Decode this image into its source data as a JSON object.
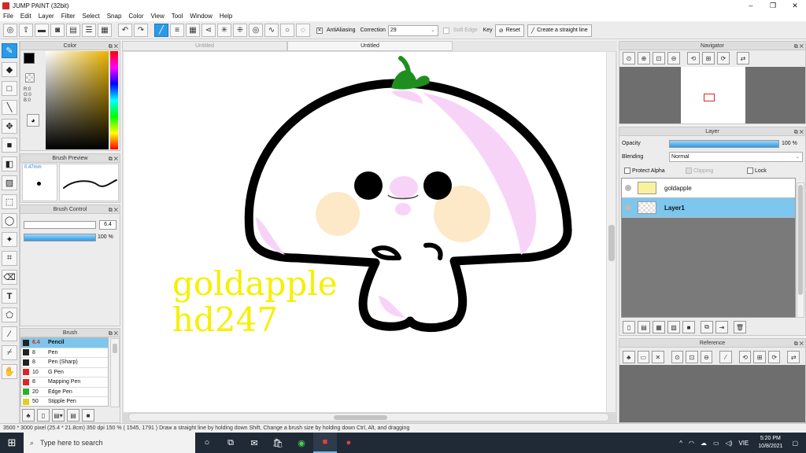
{
  "app": {
    "title": "JUMP PAINT (32bit)",
    "window_buttons": [
      "–",
      "❐",
      "✕"
    ]
  },
  "menu": [
    "File",
    "Edit",
    "Layer",
    "Filter",
    "Select",
    "Snap",
    "Color",
    "View",
    "Tool",
    "Window",
    "Help"
  ],
  "toolbar": {
    "antialiasing_label": "AntiAliasing",
    "correction_label": "Correction",
    "correction_value": "29",
    "soft_edge_label": "Soft Edge",
    "key_label": "Key",
    "reset_label": "Reset",
    "straight_line_label": "Create a straight line"
  },
  "color_panel": {
    "title": "Color",
    "r": "R:0",
    "g": "G:0",
    "b": "B:0",
    "fg_color": "#000000",
    "bg_color": "#f3b4e0"
  },
  "brush_preview": {
    "title": "Brush Preview",
    "size": "0.47mm"
  },
  "brush_control": {
    "title": "Brush Control",
    "size_value": "6.4",
    "size_fraction": 0.0,
    "opacity_value": "100 %",
    "opacity_fraction": 1.0
  },
  "brush_panel": {
    "title": "Brush",
    "items": [
      {
        "size": "6.4",
        "name": "Pencil",
        "color": "#222222"
      },
      {
        "size": "8",
        "name": "Pen",
        "color": "#222222"
      },
      {
        "size": "8",
        "name": "Pen (Sharp)",
        "color": "#222222"
      },
      {
        "size": "10",
        "name": "G Pen",
        "color": "#e02424"
      },
      {
        "size": "8",
        "name": "Mapping Pen",
        "color": "#e02424"
      },
      {
        "size": "20",
        "name": "Edge Pen",
        "color": "#2ab02a"
      },
      {
        "size": "50",
        "name": "Stipple Pen",
        "color": "#e0d020"
      }
    ]
  },
  "tabs": [
    {
      "label": "Untitled"
    },
    {
      "label": "Untitled"
    }
  ],
  "canvas_text": {
    "line1": "goldapple",
    "line2": "hd247"
  },
  "navigator": {
    "title": "Navigator"
  },
  "layer_panel": {
    "title": "Layer",
    "opacity_label": "Opacity",
    "opacity_value": "100 %",
    "opacity_fraction": 1.0,
    "blending_label": "Blending",
    "blending_value": "Normal",
    "protect_alpha": "Protect Alpha",
    "clipping": "Clipping",
    "lock": "Lock",
    "layers": [
      {
        "name": "goldapple"
      },
      {
        "name": "Layer1"
      }
    ]
  },
  "reference": {
    "title": "Reference"
  },
  "status": "3500 * 3000 pixel  (25.4 * 21.8cm)  350 dpi   150 %   ( 1545, 1791 )   Draw a straight line by holding down Shift, Change a brush size by holding down Ctrl, Alt, and dragging",
  "taskbar": {
    "search_placeholder": "Type here to search",
    "lang": "VIE",
    "time": "5:20 PM",
    "date": "10/8/2021"
  }
}
